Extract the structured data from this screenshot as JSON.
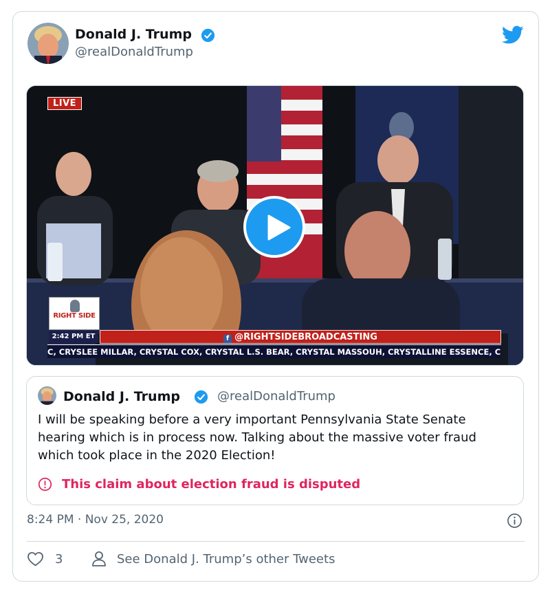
{
  "tweet": {
    "author": {
      "display_name": "Donald J. Trump",
      "handle": "@realDonaldTrump",
      "verified": true
    },
    "timestamp": "8:24 PM · Nov 25, 2020",
    "like_count": "3",
    "see_other_tweets": "See Donald J. Trump’s other Tweets"
  },
  "video": {
    "live_badge": "LIVE",
    "overlay_time": "2:42 PM ET",
    "overlay_logo": "RIGHT SIDE",
    "overlay_social": "@RIGHTSIDEBROADCASTING",
    "ticker": "C, CRYSLEE MILLAR, CRYSTAL COX, CRYSTAL L.S. BEAR, CRYSTAL MASSOUH, CRYSTALLINE ESSENCE, CUPIDS COWGIRL"
  },
  "quoted_tweet": {
    "display_name": "Donald J. Trump",
    "handle": "@realDonaldTrump",
    "text": "I will be speaking before a very important Pennsylvania State Senate hearing which is in process now. Talking about the massive voter fraud which took place in the 2020 Election!",
    "dispute_label": "This claim about election fraud is disputed"
  },
  "colors": {
    "brand_blue": "#1d9bf0",
    "dispute_red": "#e0245e",
    "secondary_text": "#536471",
    "border": "#cfd9de"
  },
  "icons": [
    "verified-badge-icon",
    "twitter-bird-icon",
    "play-icon",
    "disputed-exclamation-icon",
    "info-icon",
    "heart-icon",
    "person-icon"
  ]
}
